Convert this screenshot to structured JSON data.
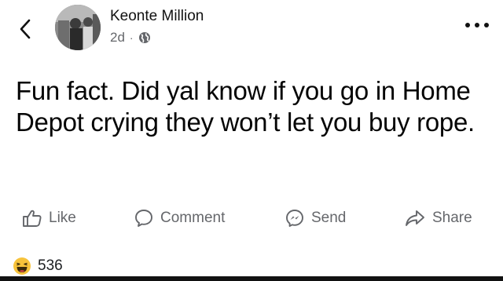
{
  "post": {
    "author": "Keonte Million",
    "time": "2d",
    "separator": "·",
    "audience_icon": "globe-icon",
    "text": "Fun fact. Did yal know if you go in Home Depot crying they won’t let you buy rope."
  },
  "actions": {
    "like_label": "Like",
    "comment_label": "Comment",
    "send_label": "Send",
    "share_label": "Share"
  },
  "reactions": {
    "icon": "haha-emoji-icon",
    "count": "536"
  },
  "colors": {
    "text_primary": "#050505",
    "text_secondary": "#65676b",
    "haha_yellow": "#f7c33b"
  }
}
